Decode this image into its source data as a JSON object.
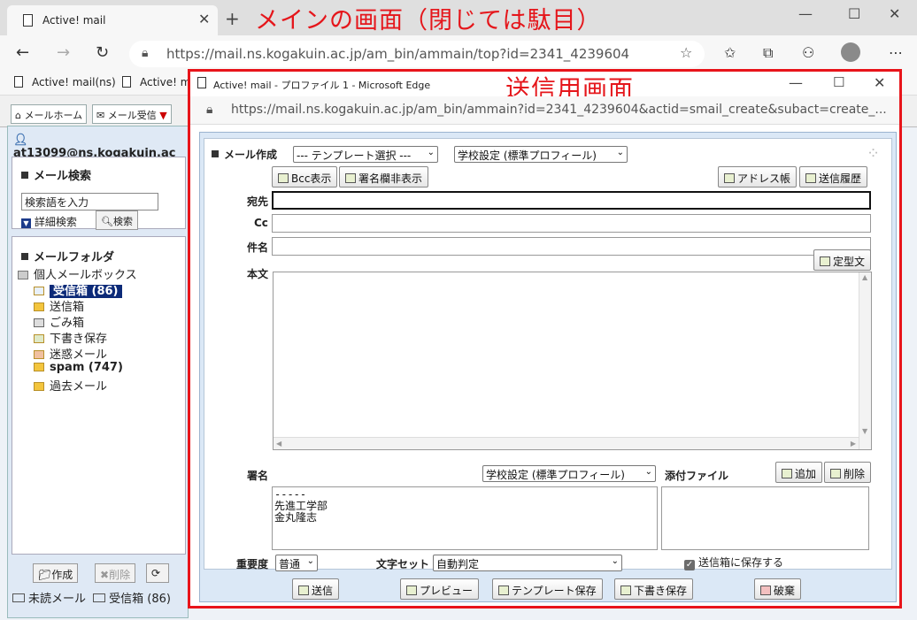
{
  "browser": {
    "tab_title": "Active! mail",
    "annotation_main": "メインの画面（閉じては駄目）",
    "url": "https://mail.ns.kogakuin.ac.jp/am_bin/ammain/top?id=2341_4239604",
    "favorites": [
      "Active! mail(ns)",
      "Active! mail"
    ]
  },
  "app": {
    "tabs": [
      "メールホーム",
      "メール受信"
    ],
    "user": "at13099@ns.kogakuin.ac",
    "search": {
      "title": "メール検索",
      "placeholder": "検索語を入力",
      "detail_label": "詳細検索",
      "search_button": "検索"
    },
    "folders": {
      "title": "メールフォルダ",
      "root": "個人メールボックス",
      "items": [
        "受信箱 (86)",
        "送信箱",
        "ごみ箱",
        "下書き保存",
        "迷惑メール",
        "spam (747)",
        "過去メール"
      ]
    },
    "bottom_buttons": [
      "作成",
      "削除"
    ],
    "status": {
      "unread": "未読メール",
      "inbox": "受信箱 (86)"
    }
  },
  "compose_window": {
    "title": "Active! mail - プロファイル 1 - Microsoft Edge",
    "annotation": "送信用画面",
    "url": "https://mail.ns.kogakuin.ac.jp/am_bin/ammain?id=2341_4239604&actid=smail_create&subact=create_...",
    "header": "メール作成",
    "template_select": "--- テンプレート選択 ---",
    "profile_select": "学校設定 (標準プロフィール)",
    "buttons": {
      "bcc": "Bcc表示",
      "signature_toggle": "署名欄非表示",
      "address_book": "アドレス帳",
      "history": "送信履歴",
      "fixed_text": "定型文",
      "add": "追加",
      "delete": "削除"
    },
    "fields": {
      "to": "宛先",
      "cc": "Cc",
      "subject": "件名",
      "body": "本文",
      "signature": "署名",
      "attachments": "添付ファイル",
      "priority": "重要度",
      "charset": "文字セット"
    },
    "signature_select": "学校設定 (標準プロフィール)",
    "signature_text": "-----\n先進工学部\n金丸隆志",
    "priority_value": "普通",
    "charset_value": "自動判定",
    "save_sent_label": "送信箱に保存する",
    "actions": [
      "送信",
      "プレビュー",
      "テンプレート保存",
      "下書き保存",
      "破棄"
    ]
  }
}
